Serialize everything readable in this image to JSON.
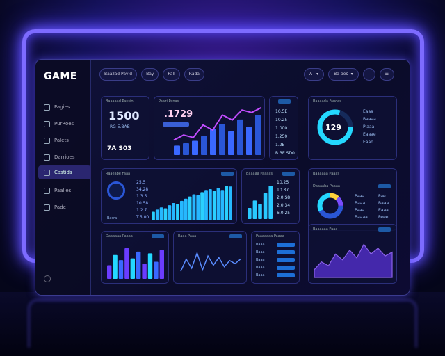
{
  "app": {
    "logo": "GAME"
  },
  "sidebar": {
    "items": [
      {
        "label": "Pagies"
      },
      {
        "label": "PurRoes"
      },
      {
        "label": "Palets"
      },
      {
        "label": "Darrioes"
      },
      {
        "label": "Castids"
      },
      {
        "label": "Paalles"
      },
      {
        "label": "Pade"
      }
    ],
    "active_index": 4
  },
  "topbar": {
    "tabs": [
      "Baazad Pavid",
      "Bay",
      "Pall",
      "Rada"
    ]
  },
  "topright": {
    "filter": "A-",
    "select": "Ba-aes"
  },
  "cards": {
    "kpi1": {
      "title": "Baaaaad Pausio",
      "value": "1500",
      "sub": "RG E.BAB",
      "bottom": "7A S03"
    },
    "kpi2": {
      "title": "Paazi Panas",
      "value": ".1729"
    },
    "list_right": {
      "label": "Eaaa",
      "values": [
        "10.5E",
        "10.25",
        "1.000",
        "1.250",
        "1.2E",
        "B.3E SD0"
      ]
    },
    "gauge": {
      "title": "Baaaada Fauoes",
      "value": "129",
      "rows": [
        "Eaaa",
        "Baaaa",
        "Plaaa",
        "Eaaae",
        "Eaan"
      ]
    },
    "mid_left": {
      "title": "Raaeabe Faaa",
      "rows": [
        "25.5",
        "34.28",
        "1.3.5",
        "10.58",
        "1.2.7",
        "T.5.00"
      ],
      "foot": "Basra"
    },
    "mid_mid": {
      "title": "Baaaaa Paaaas",
      "rows": [
        "10.25",
        "10.37",
        "2.0.S8",
        "2.0.34",
        "6.0.25"
      ]
    },
    "donut": {
      "title": "Baaaaaa Paaas",
      "subtitle": "Daaaaba Paaaa",
      "legend": [
        "Paaa",
        "Baaa",
        "Paaa",
        "Baaaa"
      ],
      "legend_vals": [
        "Pae",
        "Baaa",
        "Eaaa",
        "Peee"
      ]
    },
    "b1": {
      "title": "Daaaaaa Paaaa"
    },
    "b2": {
      "title": "Raaa Paaa"
    },
    "b3": {
      "title": "Paaaaaaa Paaaa",
      "rows": [
        "Baaa",
        "Baaa",
        "Baaa",
        "Baaa",
        "Baaa"
      ]
    },
    "b4": {
      "title": "Baaaaaa Paaa"
    }
  },
  "colors": {
    "accent": "#8a5cff",
    "cyan": "#27d6ff",
    "blue": "#2a56d6"
  },
  "chart_data": [
    {
      "type": "bar",
      "values": [
        20,
        25,
        30,
        40,
        55,
        65,
        50,
        75,
        60,
        85
      ],
      "line": [
        30,
        40,
        35,
        60,
        50,
        80,
        70,
        90,
        85,
        95
      ]
    },
    {
      "type": "bar",
      "values": [
        20,
        25,
        30,
        28,
        35,
        40,
        38,
        45,
        50,
        55,
        60,
        58,
        65,
        70,
        72,
        68,
        75,
        70,
        80,
        78
      ]
    },
    {
      "type": "bar",
      "values": [
        30,
        50,
        40,
        70,
        90
      ]
    },
    {
      "type": "bar",
      "values": [
        40,
        70,
        55,
        90,
        60,
        80,
        45,
        75,
        50,
        85
      ]
    },
    {
      "type": "line",
      "values": [
        20,
        60,
        30,
        80,
        25,
        70,
        40,
        65,
        35,
        55,
        45,
        60
      ]
    },
    {
      "type": "area",
      "values": [
        20,
        40,
        30,
        60,
        45,
        70,
        50,
        85,
        60,
        75,
        55,
        65
      ]
    }
  ]
}
